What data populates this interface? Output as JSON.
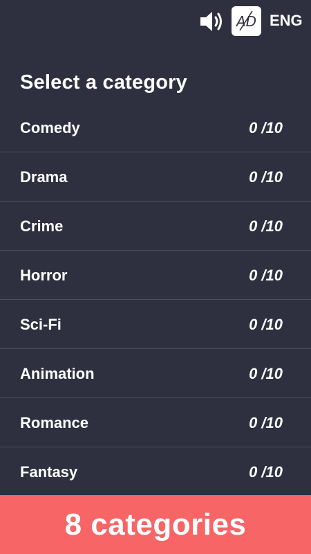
{
  "topbar": {
    "sound_icon": "speaker-volume-icon",
    "ad_label": "AD",
    "ad_icon": "no-ads-icon",
    "language": "ENG"
  },
  "title": "Select a category",
  "categories": [
    {
      "name": "Comedy",
      "score": "0 /10"
    },
    {
      "name": "Drama",
      "score": "0 /10"
    },
    {
      "name": "Crime",
      "score": "0 /10"
    },
    {
      "name": "Horror",
      "score": "0 /10"
    },
    {
      "name": "Sci-Fi",
      "score": "0 /10"
    },
    {
      "name": "Animation",
      "score": "0 /10"
    },
    {
      "name": "Romance",
      "score": "0 /10"
    },
    {
      "name": "Fantasy",
      "score": "0 /10"
    }
  ],
  "footer": {
    "label": "8 categories"
  },
  "colors": {
    "background": "#2e3040",
    "divider": "#4d5062",
    "footer": "#f76566",
    "text": "#ffffff"
  }
}
